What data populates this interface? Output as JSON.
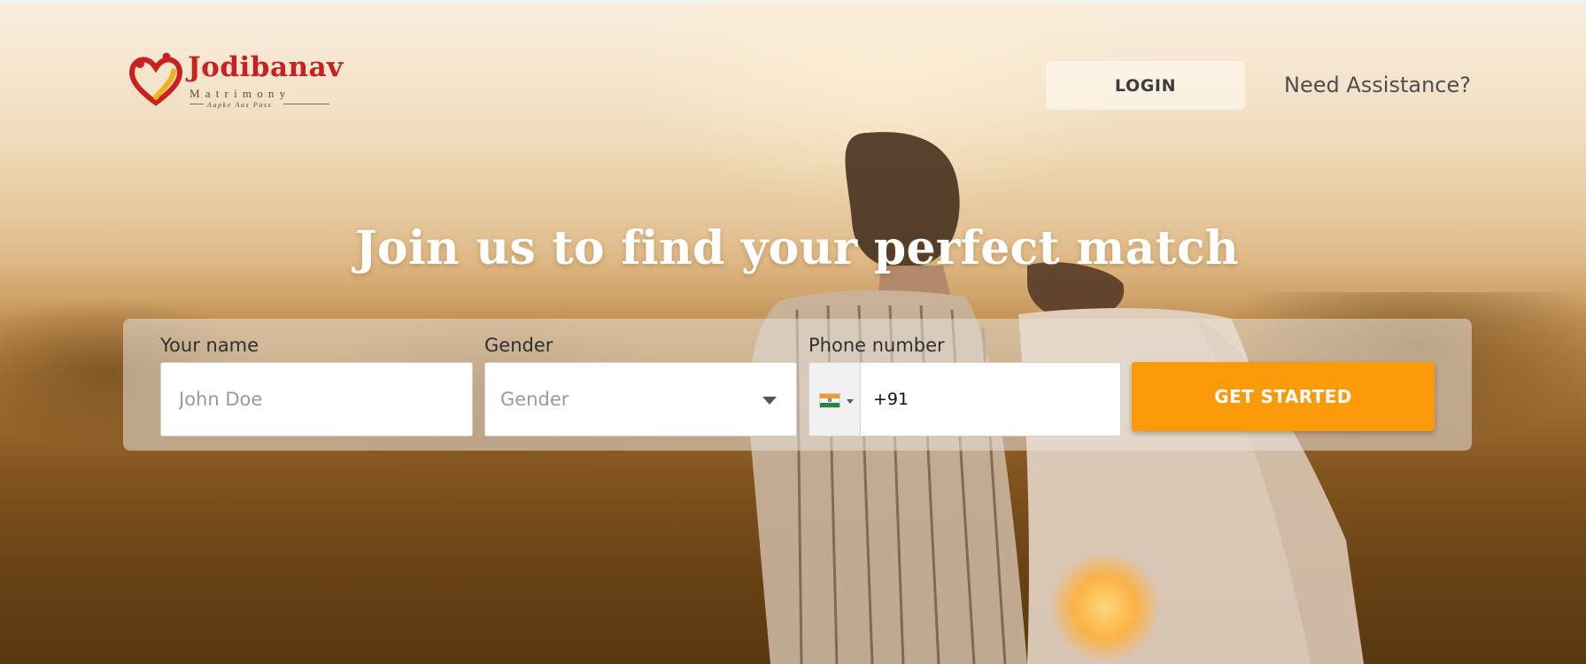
{
  "brand": {
    "name": "Jodibanav",
    "subtitle": "Matrimony",
    "tagline": "Aapke Aas Pass",
    "colors": {
      "primary": "#c8211f",
      "accent": "#fb9a08",
      "heart_gold": "#f2b21b"
    }
  },
  "header": {
    "login_label": "LOGIN",
    "assist_label": "Need Assistance?"
  },
  "hero": {
    "headline": "Join us to find your perfect match"
  },
  "form": {
    "name": {
      "label": "Your name",
      "placeholder": "John Doe"
    },
    "gender": {
      "label": "Gender",
      "placeholder": "Gender"
    },
    "phone": {
      "label": "Phone number",
      "country_flag": "india-flag-icon",
      "value": "+91"
    },
    "submit_label": "GET STARTED"
  }
}
